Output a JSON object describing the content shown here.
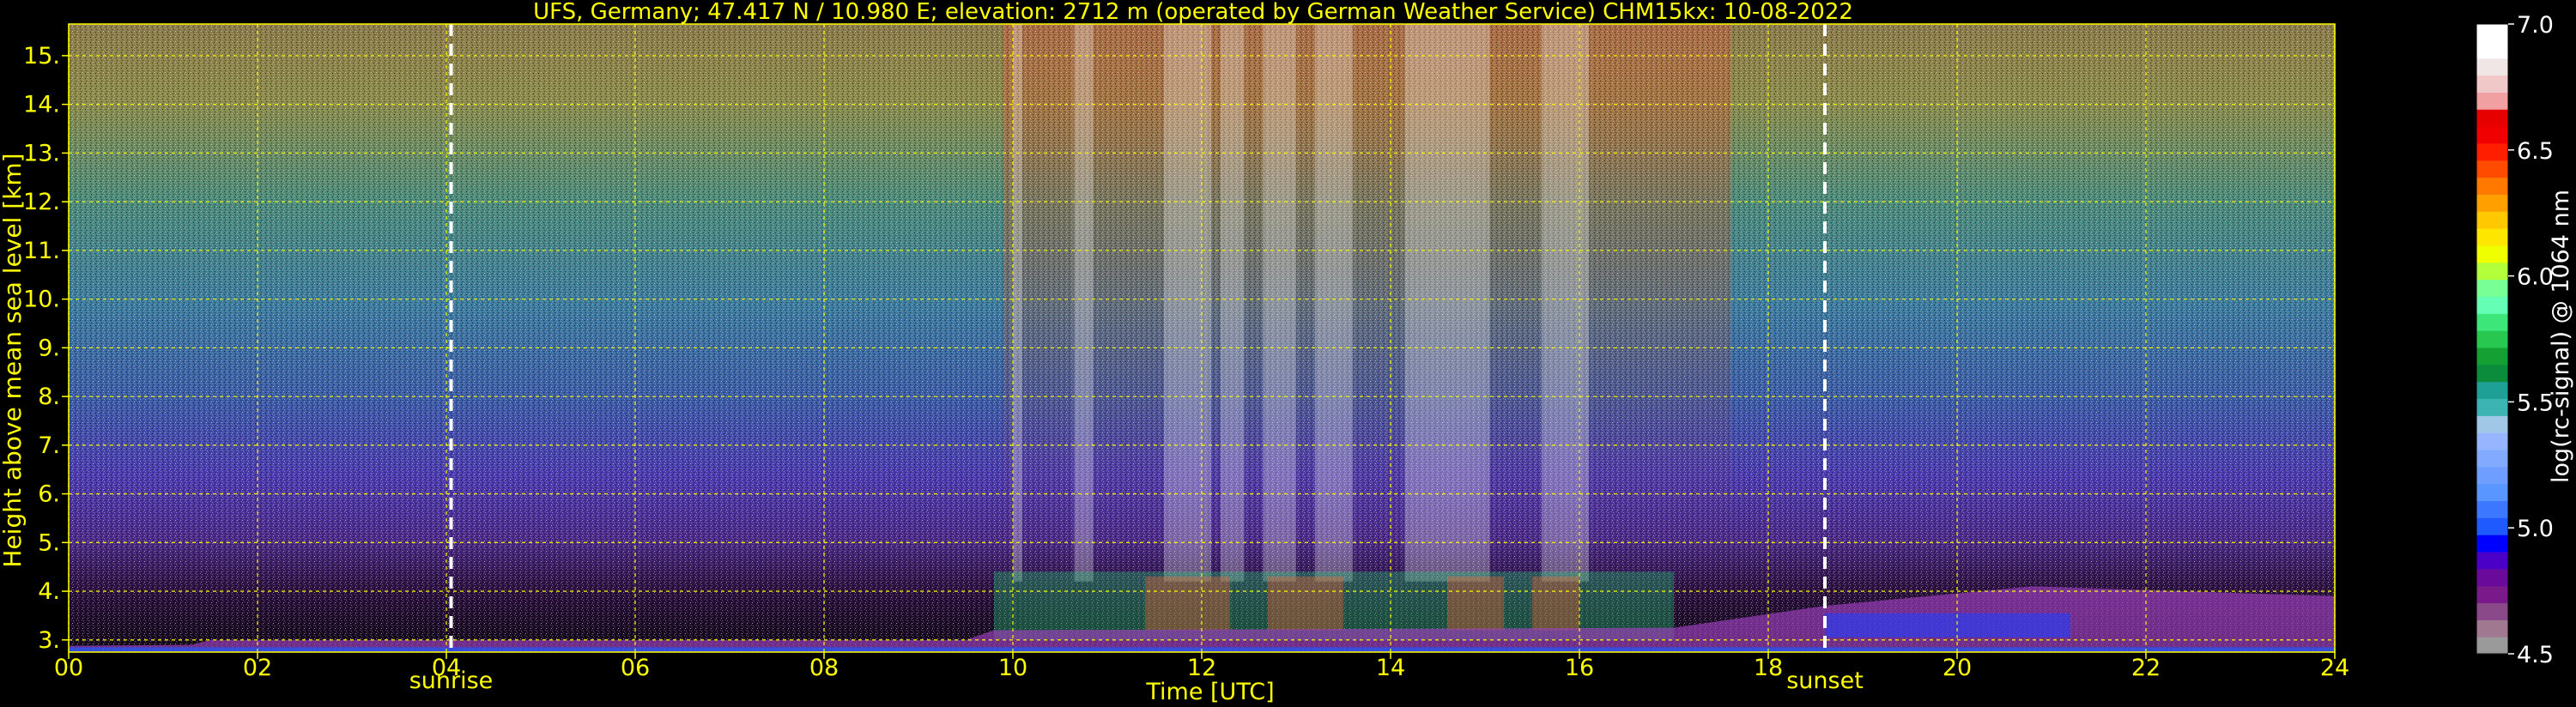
{
  "chart_data": {
    "type": "heatmap",
    "title": "UFS, Germany; 47.417 N / 10.980 E; elevation: 2712 m  (operated by German Weather Service)    CHM15kx: 10-08-2022",
    "xlabel": "Time [UTC]",
    "ylabel": "Height above mean sea level [km]",
    "xlim": [
      0,
      24
    ],
    "ylim": [
      2.75,
      15.65
    ],
    "x_ticks": [
      "00",
      "02",
      "04",
      "06",
      "08",
      "10",
      "12",
      "14",
      "16",
      "18",
      "20",
      "22",
      "24"
    ],
    "y_ticks": [
      "3.",
      "4.",
      "5.",
      "6.",
      "7.",
      "8.",
      "9.",
      "10.",
      "11.",
      "12.",
      "13.",
      "14.",
      "15."
    ],
    "grid": true,
    "markers": [
      {
        "label": "sunrise",
        "x": 4.05
      },
      {
        "label": "sunset",
        "x": 18.6
      }
    ],
    "colorbar": {
      "label": "log(rc-signal) @ 1064 nm",
      "range": [
        4.5,
        7.0
      ],
      "ticks": [
        "4.5",
        "5.0",
        "5.5",
        "6.0",
        "6.5",
        "7.0"
      ],
      "colors": [
        "#9a9a9a",
        "#a07890",
        "#8a4a8a",
        "#7a1a8a",
        "#6a0a9a",
        "#4b00c8",
        "#0000ff",
        "#1e5aff",
        "#3c78ff",
        "#5a96ff",
        "#6e9eff",
        "#82aaff",
        "#96b4ff",
        "#a0c8e6",
        "#3cb4b4",
        "#1ea096",
        "#0a8c3c",
        "#14a032",
        "#28c850",
        "#3ce678",
        "#64ffb4",
        "#78ff96",
        "#b4ff3c",
        "#f0ff00",
        "#ffe600",
        "#ffc800",
        "#ffa000",
        "#ff7800",
        "#ff4b00",
        "#ff1e00",
        "#f00000",
        "#e60000",
        "#f0a0a0",
        "#f0c8c8",
        "#f0e6e6",
        "#ffffff",
        "#ffffff"
      ]
    }
  }
}
